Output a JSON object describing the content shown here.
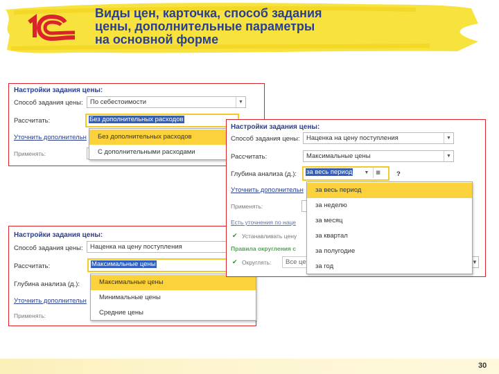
{
  "header": {
    "title_lines": [
      "Виды цен, карточка, способ задания",
      "цены, дополнительные параметры",
      "на основной форме"
    ],
    "highlight_color": "#f7e02c",
    "title_color": "#2b3f8f",
    "logo": {
      "brand_icon": "1c-logo-icon",
      "color": "#d9242b"
    }
  },
  "footer": {
    "page_number": "30"
  },
  "panel1": {
    "title": "Настройки задания цены:",
    "method_label": "Способ задания цены:",
    "method_value": "По себестоимости",
    "calc_label": "Рассчитать:",
    "calc_value": "Без дополнительных расходов",
    "more_link": "Уточнить дополнительн",
    "apply_label": "Применять:",
    "dropdown": [
      "Без дополнительных расходов",
      "С дополнительными расходами"
    ],
    "dropdown_selected": "Без дополнительных расходов"
  },
  "panel2": {
    "title": "Настройки задания цены:",
    "method_label": "Способ задания цены:",
    "method_value": "Наценка на цену поступления",
    "calc_label": "Рассчитать:",
    "calc_value": "Максимальные цены",
    "depth_label": "Глубина анализа (д.):",
    "depth_value": "за весь период",
    "more_link": "Уточнить дополнительн",
    "apply_label": "Применять:",
    "faded_link1": "Есть уточнения по наце",
    "faded_check1": "Устанавливать цену",
    "faded_rules": "Правила округления с",
    "faded_check2": "Округлять:",
    "faded_field": "Все це",
    "dropdown": [
      "за весь период",
      "за неделю",
      "за месяц",
      "за квартал",
      "за полугодие",
      "за год"
    ],
    "dropdown_selected": "за весь период",
    "help": "?"
  },
  "panel3": {
    "title": "Настройки задания цены:",
    "method_label": "Способ задания цены:",
    "method_value": "Наценка на цену поступления",
    "calc_label": "Рассчитать:",
    "calc_value": "Максимальные цены",
    "depth_label": "Глубина анализа (д.):",
    "more_link": "Уточнить дополнительн",
    "apply_label": "Применять:",
    "dropdown": [
      "Максимальные цены",
      "Минимальные цены",
      "Средние цены"
    ],
    "dropdown_selected": "Максимальные цены"
  }
}
